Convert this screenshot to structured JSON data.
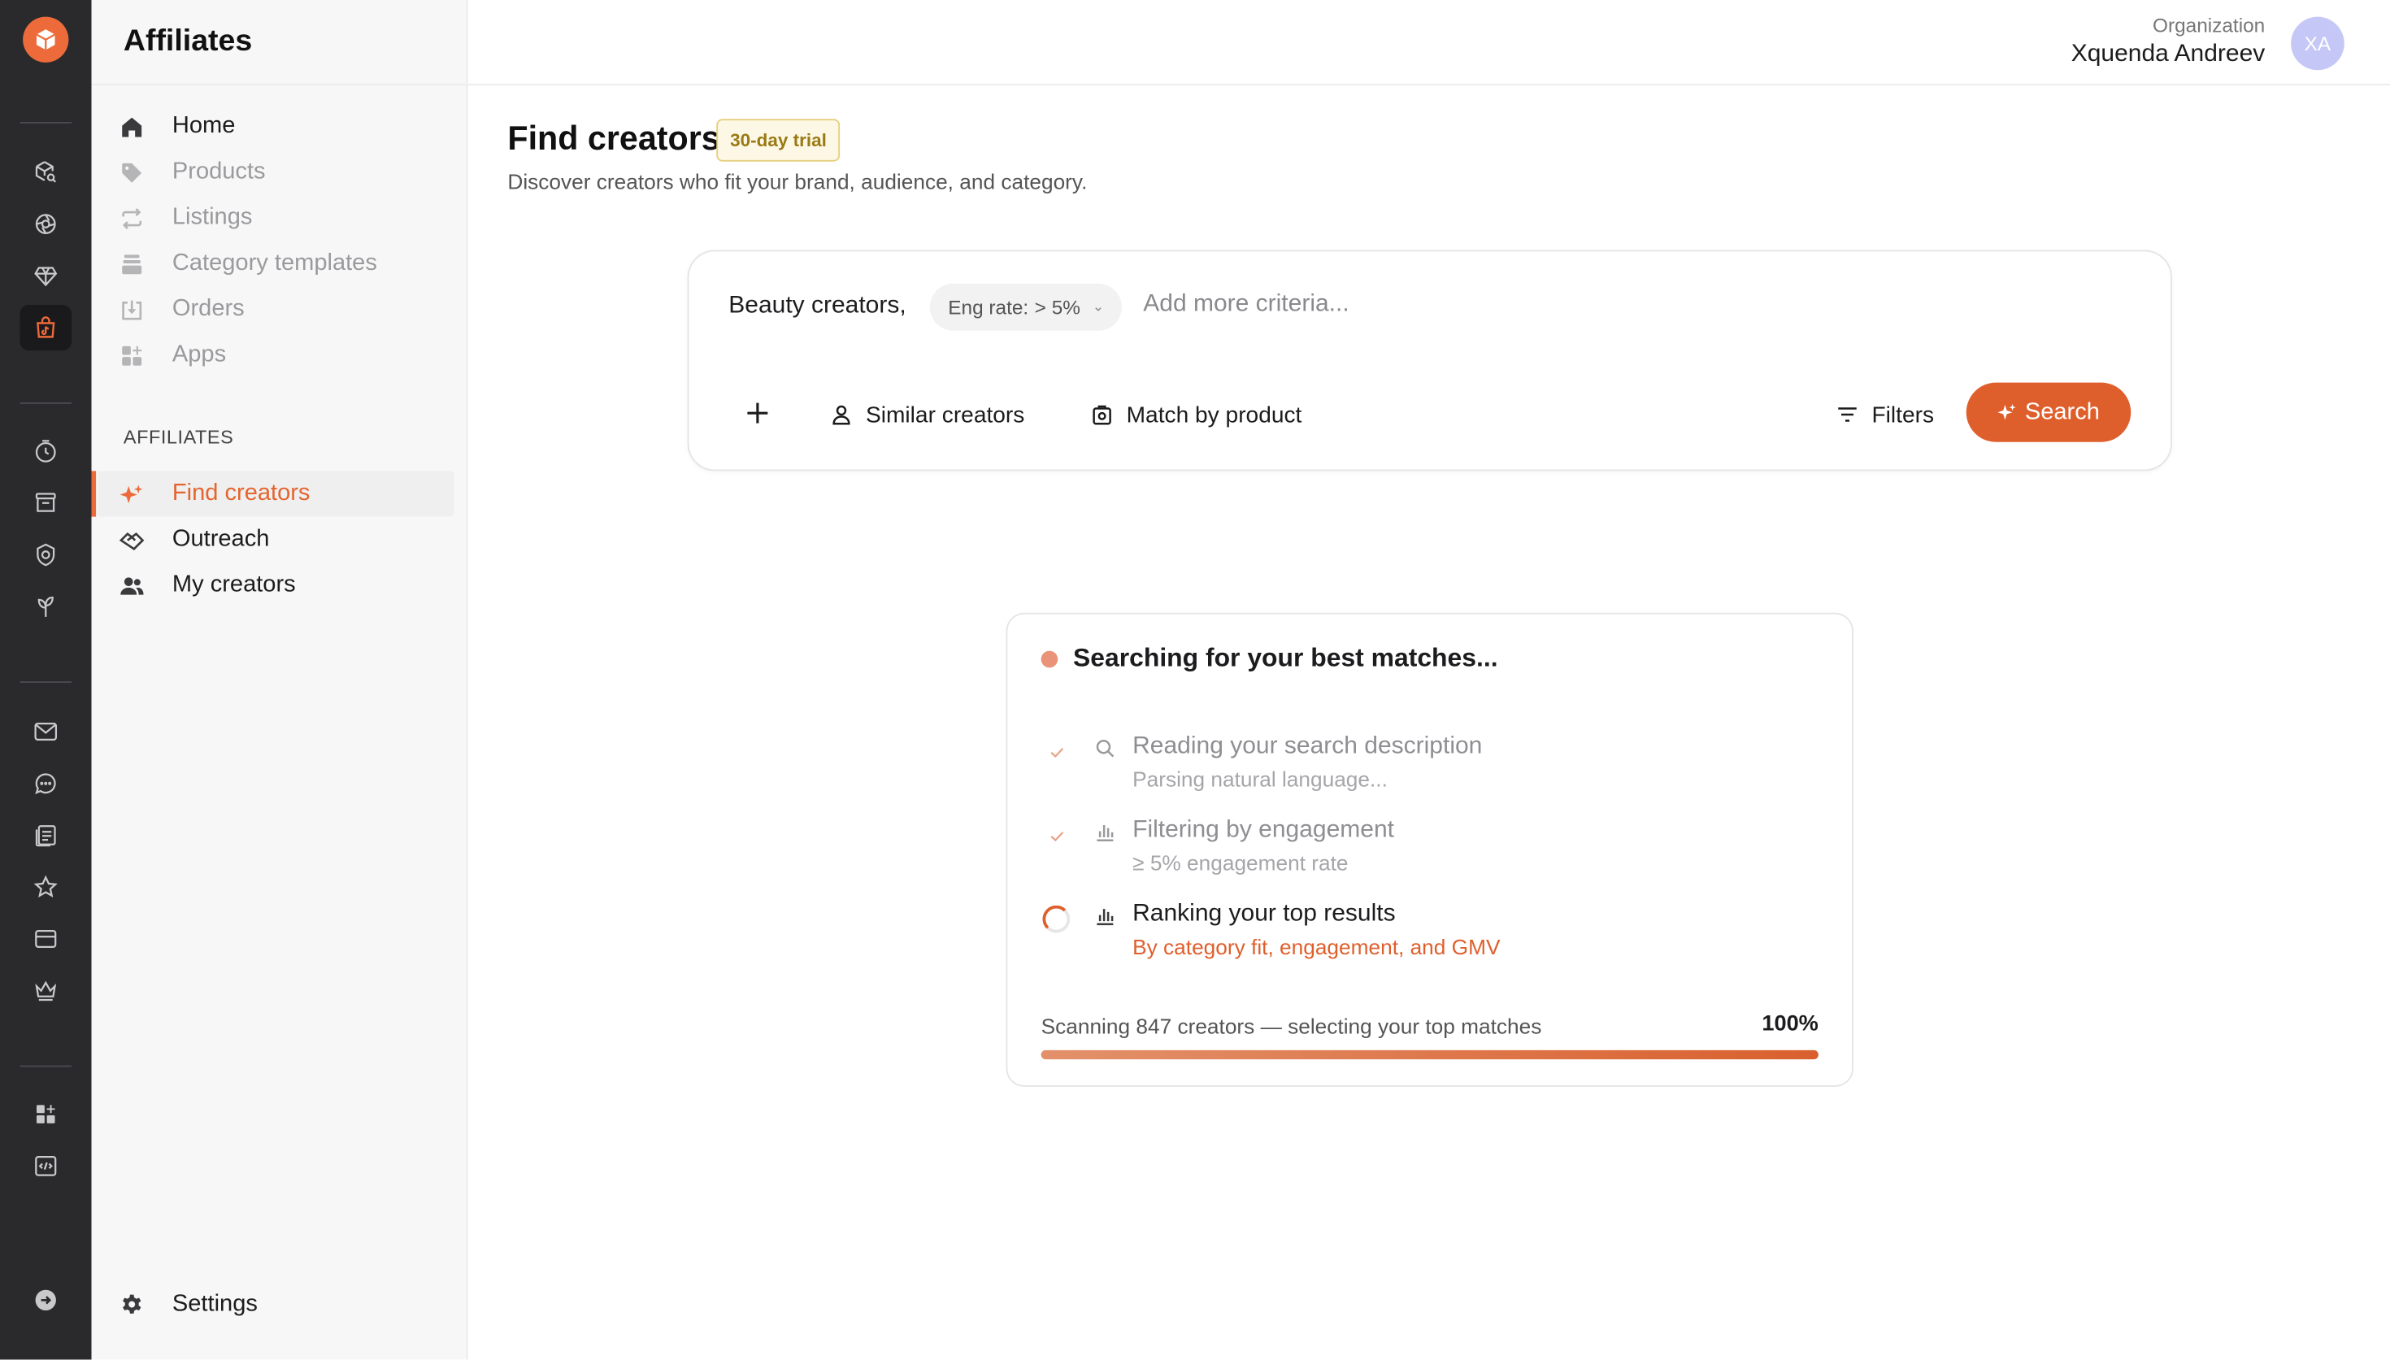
{
  "app": {
    "title": "Affiliates"
  },
  "header": {
    "org_label": "Organization",
    "org_name": "Xquenda Andreev",
    "avatar_initials": "XA"
  },
  "rail": {
    "icons": [
      "cube-search-icon",
      "aperture-icon",
      "diamond-icon",
      "shopping-bag-icon",
      "clock-icon",
      "archive-icon",
      "shield-icon",
      "plant-icon",
      "mail-icon",
      "chat-icon",
      "document-icon",
      "star-icon",
      "card-icon",
      "crown-icon",
      "apps-add-icon",
      "code-icon",
      "arrow-circle-icon"
    ],
    "active": "shopping-bag-icon"
  },
  "sidebar": {
    "items": [
      {
        "label": "Home",
        "icon": "home-icon",
        "state": "dark"
      },
      {
        "label": "Products",
        "icon": "tag-icon",
        "state": "dim"
      },
      {
        "label": "Listings",
        "icon": "repeat-icon",
        "state": "dim"
      },
      {
        "label": "Category templates",
        "icon": "layers-icon",
        "state": "dim"
      },
      {
        "label": "Orders",
        "icon": "download-box-icon",
        "state": "dim"
      },
      {
        "label": "Apps",
        "icon": "grid-icon",
        "state": "dim"
      }
    ],
    "section_label": "AFFILIATES",
    "affiliate_items": [
      {
        "label": "Find creators",
        "icon": "sparkle-icon",
        "active": true
      },
      {
        "label": "Outreach",
        "icon": "handshake-icon",
        "active": false
      },
      {
        "label": "My creators",
        "icon": "users-icon",
        "active": false
      }
    ],
    "settings_label": "Settings"
  },
  "main": {
    "title": "Find creators",
    "trial_badge": "30-day trial",
    "subtitle": "Discover creators who fit your brand, audience, and category."
  },
  "search": {
    "query": "Beauty creators,",
    "chip_label": "Eng rate:",
    "chip_value": "> 5%",
    "placeholder": "Add more criteria...",
    "similar_label": "Similar creators",
    "match_label": "Match by product",
    "filters_label": "Filters",
    "search_label": "Search"
  },
  "progress": {
    "title": "Searching for your best matches...",
    "steps": [
      {
        "label": "Reading your search description",
        "sub": "Parsing natural language...",
        "status": "done",
        "icon": "search-icon"
      },
      {
        "label": "Filtering by engagement",
        "sub": "≥ 5% engagement rate",
        "status": "done",
        "icon": "bar-chart-icon"
      },
      {
        "label": "Ranking your top results",
        "sub": "By category fit, engagement, and GMV",
        "status": "active",
        "icon": "bar-chart-icon"
      }
    ],
    "scan_text": "Scanning 847 creators — selecting your top matches",
    "percent_label": "100%",
    "percent": 100
  },
  "colors": {
    "accent": "#df5f2c",
    "rail_bg": "#2a2a2d",
    "trial_border": "#e6cf7c"
  }
}
